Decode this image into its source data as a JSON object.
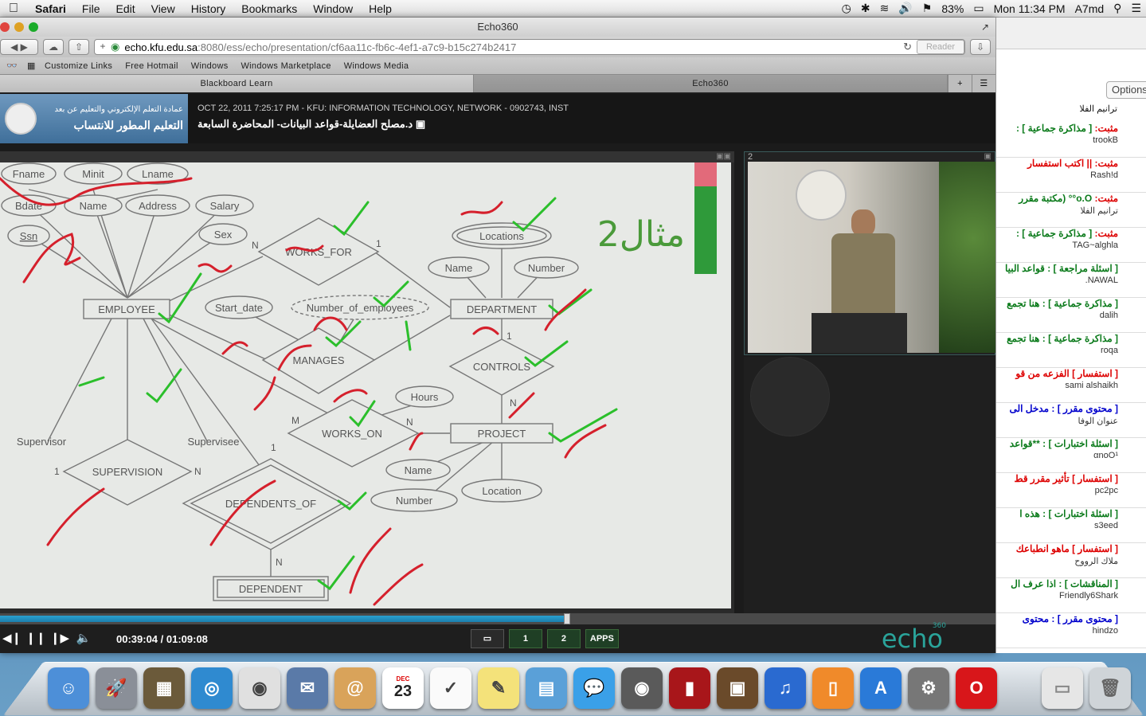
{
  "menubar": {
    "apple": "",
    "items": [
      "Safari",
      "File",
      "Edit",
      "View",
      "History",
      "Bookmarks",
      "Window",
      "Help"
    ],
    "battery": "83%",
    "clock": "Mon 11:34 PM",
    "user": "A7md"
  },
  "window": {
    "title": "Echo360",
    "url_host": "echo.kfu.edu.sa",
    "url_path": ":8080/ess/echo/presentation/cf6aa11c-fb6c-4ef1-a7c9-b15c274b2417",
    "reader": "Reader"
  },
  "bookmarks": [
    "Customize Links",
    "Free Hotmail",
    "Windows",
    "Windows Marketplace",
    "Windows Media"
  ],
  "tabs": [
    {
      "label": "Blackboard Learn",
      "active": false
    },
    {
      "label": "Echo360",
      "active": true
    }
  ],
  "echo": {
    "logo_line1": "عمادة التعلم الإلكتروني والتعليم عن بعد",
    "logo_line2": "التعليم المطور للانتساب",
    "meta_line": "OCT 22, 2011 7:25:17 PM - KFU: INFORMATION TECHNOLOGY, NETWORK - 0902743, INST",
    "lecture_title": "د.مصلح العضايلة-قواعد البيانات- المحاضرة السابعة",
    "video_number": "2",
    "time": "00:39:04 / 01:09:08",
    "progress": 0.566,
    "view_buttons": [
      "1",
      "2",
      "APPS"
    ],
    "brand": "echo",
    "brand_sup": "360"
  },
  "diagram": {
    "title_ar": "مثال2",
    "nodes": [
      {
        "label": "Fname"
      },
      {
        "label": "Minit"
      },
      {
        "label": "Lname"
      },
      {
        "label": "Bdate"
      },
      {
        "label": "Name"
      },
      {
        "label": "Address"
      },
      {
        "label": "Salary"
      },
      {
        "label": "Ssn"
      },
      {
        "label": "Sex"
      },
      {
        "label": "EMPLOYEE"
      },
      {
        "label": "WORKS_FOR"
      },
      {
        "label": "Locations"
      },
      {
        "label": "Name"
      },
      {
        "label": "Number"
      },
      {
        "label": "Start_date"
      },
      {
        "label": "Number_of_employees"
      },
      {
        "label": "DEPARTMENT"
      },
      {
        "label": "MANAGES"
      },
      {
        "label": "CONTROLS"
      },
      {
        "label": "Hours"
      },
      {
        "label": "WORKS_ON"
      },
      {
        "label": "PROJECT"
      },
      {
        "label": "Supervisor"
      },
      {
        "label": "Supervisee"
      },
      {
        "label": "SUPERVISION"
      },
      {
        "label": "Name"
      },
      {
        "label": "Location"
      },
      {
        "label": "Number"
      },
      {
        "label": "DEPENDENTS_OF"
      },
      {
        "label": "DEPENDENT"
      }
    ],
    "cardinalities": [
      "N",
      "1",
      "M",
      "N",
      "1",
      "N",
      "1",
      "N",
      "1",
      "N"
    ]
  },
  "chat": {
    "options_label": "Options",
    "items": [
      {
        "tag": "مثبت:",
        "type": "[ مذاكرة جماعية ] :",
        "user": "trookB"
      },
      {
        "tag": "مثبت:",
        "type": "|| اكتب استفسار",
        "user": "Rash!d"
      },
      {
        "tag": "مثبت:",
        "type": "o.O°° (مكتبة مقرر",
        "user": "ترانيم الفلا"
      },
      {
        "tag": "مثبت:",
        "type": "[ مذاكرة جماعية ] :",
        "user": "TAG~alghla"
      },
      {
        "tag": "",
        "type": "[ اسئلة مراجعة ] : قواعد البيا",
        "user": "NAWAL."
      },
      {
        "tag": "",
        "type": "[ مذاكرة جماعية ] : هنا تجمع",
        "user": "dalih"
      },
      {
        "tag": "",
        "type": "[ مذاكرة جماعية ] : هنا تجمع",
        "user": "roqa"
      },
      {
        "tag": "",
        "type": "[ استفسار ] الفزعه من قو",
        "user": "sami alshaikh"
      },
      {
        "tag": "",
        "type": "[ محتوى مقرر ] : مدخل الى",
        "user": "عنوان الوفا"
      },
      {
        "tag": "",
        "type": "[ اسئلة اختبارات ] : **قواعد",
        "user": "αnoO¹"
      },
      {
        "tag": "",
        "type": "[ استفسار ] تأثير مقرر قط",
        "user": "pc2pc"
      },
      {
        "tag": "",
        "type": "[ اسئلة اختبارات ] : هذه ا",
        "user": "s3eed"
      },
      {
        "tag": "",
        "type": "[ استفسار ] ماهو انطباعك",
        "user": "ملاك الرووح"
      },
      {
        "tag": "",
        "type": "[ المناقشات ] : اذا عرف ال",
        "user": "Friendly6Shark"
      },
      {
        "tag": "",
        "type": "[ محتوى مقرر ] : محتوى",
        "user": "hindzo"
      }
    ],
    "top_user": "ترانيم الفلا"
  },
  "dock": {
    "apps": [
      "Finder",
      "Launchpad",
      "Photo Booth",
      "Safari",
      "Chrome",
      "Mail",
      "Contacts",
      "Calendar",
      "Reminders",
      "Notes",
      "Preview",
      "Messages",
      "FaceTime",
      "Photo Booth 2",
      "iPhoto",
      "iTunes",
      "iBooks",
      "App Store",
      "System Preferences",
      "Opera"
    ],
    "calendar_day": "23",
    "calendar_month": "DEC"
  }
}
